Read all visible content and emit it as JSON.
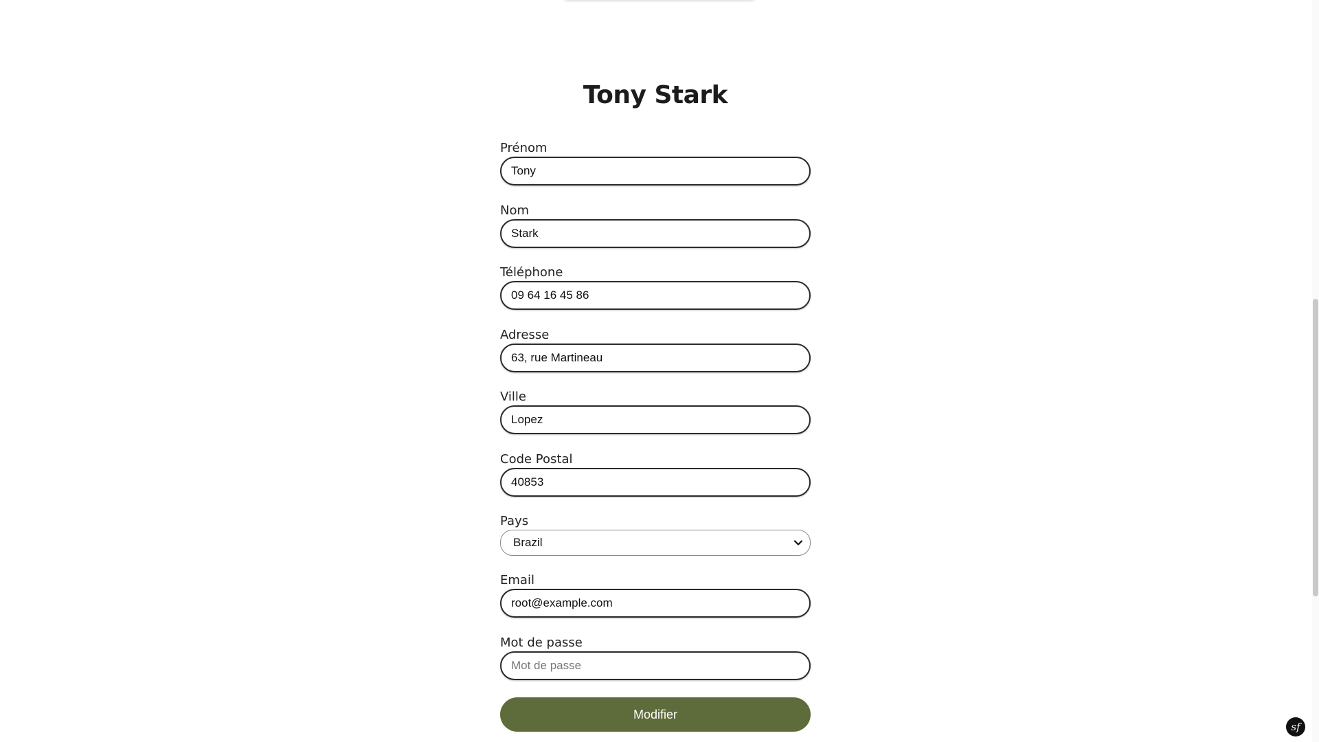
{
  "profile": {
    "title": "Tony Stark"
  },
  "form": {
    "fields": [
      {
        "label": "Prénom",
        "value": "Tony",
        "placeholder": ""
      },
      {
        "label": "Nom",
        "value": "Stark",
        "placeholder": ""
      },
      {
        "label": "Téléphone",
        "value": "09 64 16 45 86",
        "placeholder": ""
      },
      {
        "label": "Adresse",
        "value": "63, rue Martineau",
        "placeholder": ""
      },
      {
        "label": "Ville",
        "value": "Lopez",
        "placeholder": ""
      },
      {
        "label": "Code Postal",
        "value": "40853",
        "placeholder": ""
      }
    ],
    "country": {
      "label": "Pays",
      "selected": "Brazil"
    },
    "email": {
      "label": "Email",
      "value": "root@example.com"
    },
    "password": {
      "label": "Mot de passe",
      "value": "",
      "placeholder": "Mot de passe"
    },
    "submit_label": "Modifier"
  },
  "badge": {
    "glyph": "sf",
    "icon": "symfony-logo-icon"
  },
  "colors": {
    "accent": "#5e6b3a",
    "border": "#2a2a2a"
  }
}
